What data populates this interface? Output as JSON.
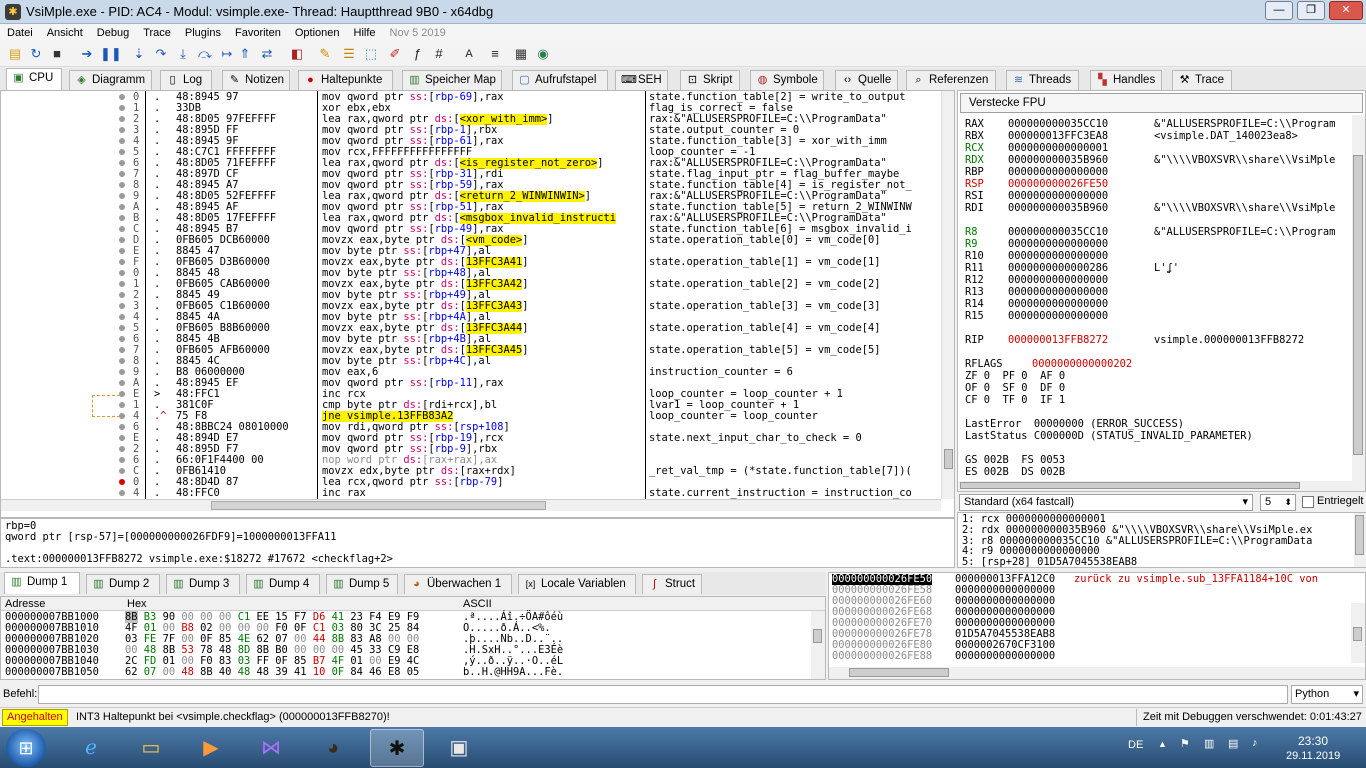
{
  "window": {
    "title": "VsiMple.exe - PID: AC4 - Modul: vsimple.exe- Thread: Hauptthread 9B0 - x64dbg"
  },
  "menu": [
    "Datei",
    "Ansicht",
    "Debug",
    "Trace",
    "Plugins",
    "Favoriten",
    "Optionen",
    "Hilfe"
  ],
  "build_date": "Nov 5 2019",
  "tabs": [
    {
      "label": "CPU",
      "icon": "cpu-icon"
    },
    {
      "label": "Diagramm",
      "icon": "graph-icon"
    },
    {
      "label": "Log",
      "icon": "log-icon"
    },
    {
      "label": "Notizen",
      "icon": "notes-icon"
    },
    {
      "label": "Haltepunkte",
      "icon": "breakpoint-icon"
    },
    {
      "label": "Speicher Map",
      "icon": "memory-map-icon"
    },
    {
      "label": "Aufrufstapel",
      "icon": "callstack-icon"
    },
    {
      "label": "SEH",
      "icon": "seh-icon"
    },
    {
      "label": "Skript",
      "icon": "script-icon"
    },
    {
      "label": "Symbole",
      "icon": "symbols-icon"
    },
    {
      "label": "Quelle",
      "icon": "source-icon"
    },
    {
      "label": "Referenzen",
      "icon": "references-icon"
    },
    {
      "label": "Threads",
      "icon": "threads-icon"
    },
    {
      "label": "Handles",
      "icon": "handles-icon"
    },
    {
      "label": "Trace",
      "icon": "trace-icon"
    }
  ],
  "disasm": [
    {
      "m": "0",
      "b": ".",
      "bytes": "48:8945 97",
      "ins": "mov qword ptr ss:[rbp-69],rax",
      "com": "state.function_table[2] = write_to_output"
    },
    {
      "m": "1",
      "b": ".",
      "bytes": "33DB",
      "ins": "xor ebx,ebx",
      "com": "flag_is_correct = false"
    },
    {
      "m": "2",
      "b": ".",
      "bytes": "48:8D05 97FEFFFF",
      "ins": "lea rax,qword ptr ds:[<xor_with_imm>]",
      "com": "rax:&\"ALLUSERSPROFILE=C:\\\\ProgramData\""
    },
    {
      "m": "3",
      "b": ".",
      "bytes": "48:895D FF",
      "ins": "mov qword ptr ss:[rbp-1],rbx",
      "com": "state.output_counter = 0"
    },
    {
      "m": "4",
      "b": ".",
      "bytes": "48:8945 9F",
      "ins": "mov qword ptr ss:[rbp-61],rax",
      "com": "state.function_table[3] = xor_with_imm"
    },
    {
      "m": "5",
      "b": ".",
      "bytes": "48:C7C1 FFFFFFFF",
      "ins": "mov rcx,FFFFFFFFFFFFFFFF",
      "com": "loop_counter = -1"
    },
    {
      "m": "6",
      "b": ".",
      "bytes": "48:8D05 71FEFFFF",
      "ins": "lea rax,qword ptr ds:[<is_register_not_zero>]",
      "com": "rax:&\"ALLUSERSPROFILE=C:\\\\ProgramData\""
    },
    {
      "m": "7",
      "b": ".",
      "bytes": "48:897D CF",
      "ins": "mov qword ptr ss:[rbp-31],rdi",
      "com": "state.flag_input_ptr = flag_buffer_maybe"
    },
    {
      "m": "8",
      "b": ".",
      "bytes": "48:8945 A7",
      "ins": "mov qword ptr ss:[rbp-59],rax",
      "com": "state.function_table[4] = is_register_not_"
    },
    {
      "m": "9",
      "b": ".",
      "bytes": "48:8D05 52FEFFFF",
      "ins": "lea rax,qword ptr ds:[<return_2_WINWINWIN>]",
      "com": "rax:&\"ALLUSERSPROFILE=C:\\\\ProgramData\""
    },
    {
      "m": "A",
      "b": ".",
      "bytes": "48:8945 AF",
      "ins": "mov qword ptr ss:[rbp-51],rax",
      "com": "state.function_table[5] = return_2_WINWINW"
    },
    {
      "m": "B",
      "b": ".",
      "bytes": "48:8D05 17FEFFFF",
      "ins": "lea rax,qword ptr ds:[<msgbox_invalid_instructi",
      "com": "rax:&\"ALLUSERSPROFILE=C:\\\\ProgramData\""
    },
    {
      "m": "C",
      "b": ".",
      "bytes": "48:8945 B7",
      "ins": "mov qword ptr ss:[rbp-49],rax",
      "com": "state.function_table[6] = msgbox_invalid_i"
    },
    {
      "m": "D",
      "b": ".",
      "bytes": "0FB605 DCB60000",
      "ins": "movzx eax,byte ptr ds:[<vm_code>]",
      "com": "state.operation_table[0] = vm_code[0]"
    },
    {
      "m": "E",
      "b": ".",
      "bytes": "8845 47",
      "ins": "mov byte ptr ss:[rbp+47],al",
      "com": ""
    },
    {
      "m": "F",
      "b": ".",
      "bytes": "0FB605 D3B60000",
      "ins": "movzx eax,byte ptr ds:[13FFC3A41]",
      "com": "state.operation_table[1] = vm_code[1]"
    },
    {
      "m": "0",
      "b": ".",
      "bytes": "8845 48",
      "ins": "mov byte ptr ss:[rbp+48],al",
      "com": ""
    },
    {
      "m": "1",
      "b": ".",
      "bytes": "0FB605 CAB60000",
      "ins": "movzx eax,byte ptr ds:[13FFC3A42]",
      "com": "state.operation_table[2] = vm_code[2]"
    },
    {
      "m": "2",
      "b": ".",
      "bytes": "8845 49",
      "ins": "mov byte ptr ss:[rbp+49],al",
      "com": ""
    },
    {
      "m": "3",
      "b": ".",
      "bytes": "0FB605 C1B60000",
      "ins": "movzx eax,byte ptr ds:[13FFC3A43]",
      "com": "state.operation_table[3] = vm_code[3]"
    },
    {
      "m": "4",
      "b": ".",
      "bytes": "8845 4A",
      "ins": "mov byte ptr ss:[rbp+4A],al",
      "com": ""
    },
    {
      "m": "5",
      "b": ".",
      "bytes": "0FB605 B8B60000",
      "ins": "movzx eax,byte ptr ds:[13FFC3A44]",
      "com": "state.operation_table[4] = vm_code[4]"
    },
    {
      "m": "6",
      "b": ".",
      "bytes": "8845 4B",
      "ins": "mov byte ptr ss:[rbp+4B],al",
      "com": ""
    },
    {
      "m": "7",
      "b": ".",
      "bytes": "0FB605 AFB60000",
      "ins": "movzx eax,byte ptr ds:[13FFC3A45]",
      "com": "state.operation_table[5] = vm_code[5]"
    },
    {
      "m": "8",
      "b": ".",
      "bytes": "8845 4C",
      "ins": "mov byte ptr ss:[rbp+4C],al",
      "com": ""
    },
    {
      "m": "9",
      "b": ".",
      "bytes": "B8 06000000",
      "ins": "mov eax,6",
      "com": "instruction_counter = 6"
    },
    {
      "m": "A",
      "b": ".",
      "bytes": "48:8945 EF",
      "ins": "mov qword ptr ss:[rbp-11],rax",
      "com": ""
    },
    {
      "m": "E",
      "b": ">",
      "bytes": "48:FFC1",
      "ins": "inc rcx",
      "com": "loop_counter = loop_counter + 1"
    },
    {
      "m": "1",
      "b": ".",
      "bytes": "381C0F",
      "ins": "cmp byte ptr ds:[rdi+rcx],bl",
      "com": "lvar1 = loop_counter + 1"
    },
    {
      "m": "4",
      "b": ".^",
      "bytes": "75 F8",
      "ins": "jne vsimple.13FFB83A2",
      "com": "loop_counter = loop_counter"
    },
    {
      "m": "6",
      "b": ".",
      "bytes": "48:8BBC24 08010000",
      "ins": "mov rdi,qword ptr ss:[rsp+108]",
      "com": ""
    },
    {
      "m": "E",
      "b": ".",
      "bytes": "48:894D E7",
      "ins": "mov qword ptr ss:[rbp-19],rcx",
      "com": "state.next_input_char_to_check = 0"
    },
    {
      "m": "2",
      "b": ".",
      "bytes": "48:895D F7",
      "ins": "mov qword ptr ss:[rbp-9],rbx",
      "com": ""
    },
    {
      "m": "6",
      "b": ".",
      "bytes": "66:0F1F4400 00",
      "ins": "nop word ptr ds:[rax+rax],ax",
      "com": ""
    },
    {
      "m": "C",
      "b": ".",
      "bytes": "0FB61410",
      "ins": "movzx edx,byte ptr ds:[rax+rdx]",
      "com": "_ret_val_tmp = (*state.function_table[7])("
    },
    {
      "m": "0",
      "b": ".",
      "bytes": "48:8D4D 87",
      "ins": "lea rcx,qword ptr ss:[rbp-79]",
      "com": ""
    },
    {
      "m": "4",
      "b": ".",
      "bytes": "48:FFC0",
      "ins": "inc rax",
      "com": "state.current_instruction = instruction_co"
    }
  ],
  "registers": {
    "hide_fpu": "Verstecke FPU",
    "gp": [
      {
        "n": "RAX",
        "v": "000000000035CC10",
        "c": "&\"ALLUSERSPROFILE=C:\\\\Program"
      },
      {
        "n": "RBX",
        "v": "000000013FFC3EA8",
        "c": "<vsimple.DAT_140023ea8>"
      },
      {
        "n": "RCX",
        "v": "0000000000000001",
        "c": ""
      },
      {
        "n": "RDX",
        "v": "000000000035B960",
        "c": "&\"\\\\\\\\VBOXSVR\\\\share\\\\VsiMple"
      },
      {
        "n": "RBP",
        "v": "0000000000000000",
        "c": ""
      },
      {
        "n": "RSP",
        "v": "000000000026FE50",
        "c": ""
      },
      {
        "n": "RSI",
        "v": "0000000000000000",
        "c": ""
      },
      {
        "n": "RDI",
        "v": "000000000035B960",
        "c": "&\"\\\\\\\\VBOXSVR\\\\share\\\\VsiMple"
      }
    ],
    "ext": [
      {
        "n": "R8",
        "v": "000000000035CC10",
        "c": "&\"ALLUSERSPROFILE=C:\\\\Program"
      },
      {
        "n": "R9",
        "v": "0000000000000000",
        "c": ""
      },
      {
        "n": "R10",
        "v": "0000000000000000",
        "c": ""
      },
      {
        "n": "R11",
        "v": "0000000000000286",
        "c": "L'ʆ'"
      },
      {
        "n": "R12",
        "v": "0000000000000000",
        "c": ""
      },
      {
        "n": "R13",
        "v": "0000000000000000",
        "c": ""
      },
      {
        "n": "R14",
        "v": "0000000000000000",
        "c": ""
      },
      {
        "n": "R15",
        "v": "0000000000000000",
        "c": ""
      }
    ],
    "rip": {
      "n": "RIP",
      "v": "000000013FFB8272",
      "c": "vsimple.000000013FFB8272"
    },
    "rflags": {
      "n": "RFLAGS",
      "v": "0000000000000202"
    },
    "flags": [
      "ZF 0  PF 0  AF 0",
      "OF 0  SF 0  DF 0",
      "CF 0  TF 0  IF 1"
    ],
    "lasterror": "LastError  00000000 (ERROR_SUCCESS)",
    "laststatus": "LastStatus C000000D (STATUS_INVALID_PARAMETER)",
    "segs": [
      "GS 002B  FS 0053",
      "ES 002B  DS 002B"
    ]
  },
  "callconv": {
    "value": "Standard (x64 fastcall)",
    "count": "5",
    "checkbox_label": "Entriegelt"
  },
  "callargs": [
    "1: rcx 0000000000000001",
    "2: rdx 000000000035B960 &\"\\\\\\\\VBOXSVR\\\\share\\\\VsiMple.ex",
    "3: r8 000000000035CC10 &\"ALLUSERSPROFILE=C:\\\\ProgramData",
    "4: r9 0000000000000000",
    "5: [rsp+28] 01D5A7045538EAB8"
  ],
  "info": [
    "rbp=0",
    "qword ptr [rsp-57]=[000000000026FDF9]=1000000013FFA11",
    "",
    ".text:000000013FFB8272 vsimple.exe:$18272 #17672 <checkflag+2>"
  ],
  "dump_tabs": [
    "Dump 1",
    "Dump 2",
    "Dump 3",
    "Dump 4",
    "Dump 5",
    "Überwachen 1",
    "Locale Variablen",
    "Struct"
  ],
  "dump_headers": {
    "addr": "Adresse",
    "hex": "Hex",
    "ascii": "ASCII"
  },
  "dump_rows": [
    {
      "a": "000000007BB1000",
      "h": "8B B3 90 00 00 00 C1 EE 15 F7 D6 41 23 F4 E9 F9",
      "t": ".ª....Áî.÷ÖA#ôéù"
    },
    {
      "a": "000000007BB1010",
      "h": "4F 01 00 B8 02 00 00 00 F0 0F C1 03 80 3C 25 84",
      "t": "O.....ð.Á..<%."
    },
    {
      "a": "000000007BB1020",
      "h": "03 FE 7F 00 0F 85 4E 62 07 00 44 8B 83 A8 00 00",
      "t": ".þ....Nb..D..¨.."
    },
    {
      "a": "000000007BB1030",
      "h": "00 48 8B 53 78 48 8D 8B B0 00 00 00 45 33 C9 E8",
      "t": ".H.SxH..°...E3Éè"
    },
    {
      "a": "000000007BB1040",
      "h": "2C FD 01 00 F0 83 03 FF 0F 85 B7 4F 01 00 E9 4C",
      "t": ",ý..ð..ÿ..·O..éL"
    },
    {
      "a": "000000007BB1050",
      "h": "62 07 00 48 8B 40 48 48 39 41 10 0F 84 46 E8 05",
      "t": "b..H.@HH9A...Fè."
    }
  ],
  "stack_rows": [
    {
      "a": "000000000026FE50",
      "v": "000000013FFA12C0",
      "c": "zurück zu vsimple.sub_13FFA1184+10C von"
    },
    {
      "a": "000000000026FE58",
      "v": "0000000000000000",
      "c": ""
    },
    {
      "a": "000000000026FE60",
      "v": "0000000000000000",
      "c": ""
    },
    {
      "a": "000000000026FE68",
      "v": "0000000000000000",
      "c": ""
    },
    {
      "a": "000000000026FE70",
      "v": "0000000000000000",
      "c": ""
    },
    {
      "a": "000000000026FE78",
      "v": "01D5A7045538EAB8",
      "c": ""
    },
    {
      "a": "000000000026FE80",
      "v": "0000002670CF3100",
      "c": ""
    },
    {
      "a": "000000000026FE88",
      "v": "0000000000000000",
      "c": ""
    }
  ],
  "cmd": {
    "label": "Befehl:",
    "value": "",
    "lang": "Python"
  },
  "status": {
    "state": "Angehalten",
    "message": "INT3 Haltepunkt bei <vsimple.checkflag> (000000013FFB8270)!",
    "time": "Zeit mit Debuggen verschwendet: 0:01:43:27"
  },
  "taskbar": {
    "lang": "DE",
    "time": "23:30",
    "date": "29.11.2019"
  },
  "colors": {
    "highlight": "#fff200",
    "accent_red": "#cc0000",
    "titlebar": "#c9d9ea",
    "status_state_bg": "#ffff00"
  }
}
